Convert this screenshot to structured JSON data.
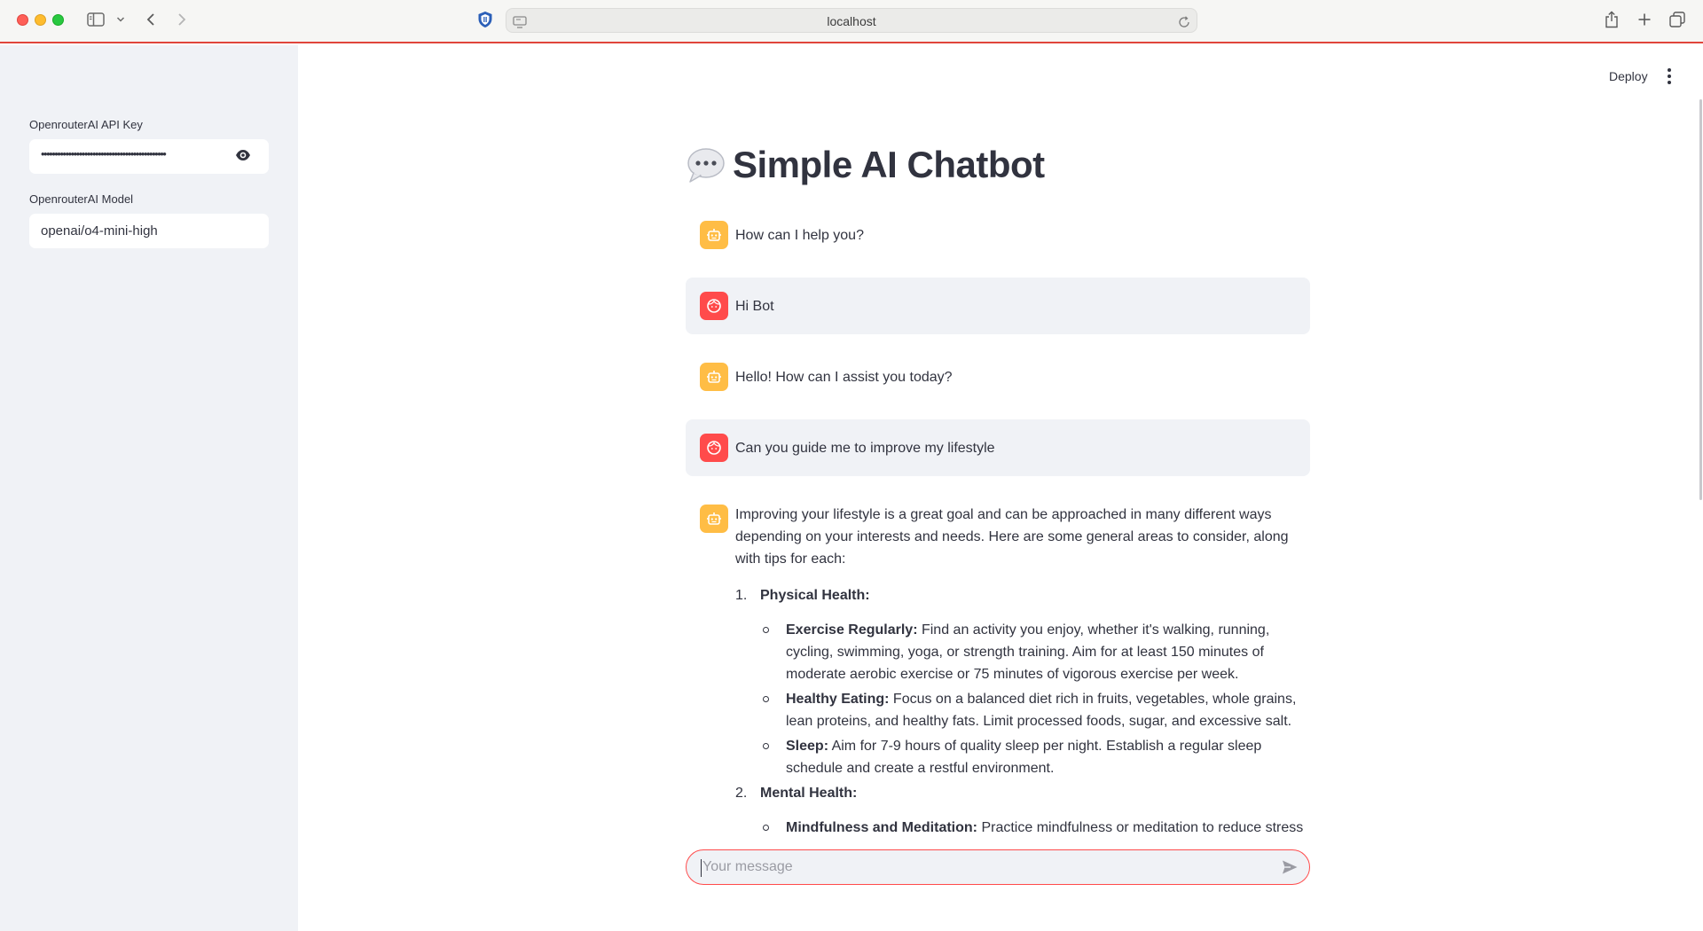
{
  "browser": {
    "url": "localhost"
  },
  "sidebar": {
    "api_key_label": "OpenrouterAI API Key",
    "api_key_value": "••••••••••••••••••••••••••••••••••••••••••••••",
    "model_label": "OpenrouterAI Model",
    "model_value": "openai/o4-mini-high"
  },
  "header": {
    "deploy_label": "Deploy"
  },
  "main": {
    "title": "Simple AI Chatbot",
    "messages": [
      {
        "role": "assistant",
        "text": "How can I help you?"
      },
      {
        "role": "user",
        "text": "Hi Bot"
      },
      {
        "role": "assistant",
        "text": "Hello! How can I assist you today?"
      },
      {
        "role": "user",
        "text": "Can you guide me to improve my lifestyle"
      }
    ],
    "answer": {
      "intro": "Improving your lifestyle is a great goal and can be approached in many different ways depending on your interests and needs. Here are some general areas to consider, along with tips for each:",
      "sections": [
        {
          "number": "1.",
          "title": "Physical Health:",
          "items": [
            {
              "label": "Exercise Regularly:",
              "text": " Find an activity you enjoy, whether it's walking, running, cycling, swimming, yoga, or strength training. Aim for at least 150 minutes of moderate aerobic exercise or 75 minutes of vigorous exercise per week."
            },
            {
              "label": "Healthy Eating:",
              "text": " Focus on a balanced diet rich in fruits, vegetables, whole grains, lean proteins, and healthy fats. Limit processed foods, sugar, and excessive salt."
            },
            {
              "label": "Sleep:",
              "text": " Aim for 7-9 hours of quality sleep per night. Establish a regular sleep schedule and create a restful environment."
            }
          ]
        },
        {
          "number": "2.",
          "title": "Mental Health:",
          "items": [
            {
              "label": "Mindfulness and Meditation:",
              "text": " Practice mindfulness or meditation to reduce stress and improve mental clarity. Even a few minutes a day can make a difference."
            }
          ]
        }
      ]
    }
  },
  "chat_input": {
    "placeholder": "Your message"
  },
  "colors": {
    "bot_avatar": "#ffbd45",
    "user_avatar": "#ff4b4b",
    "sidebar_bg": "#f0f2f6",
    "accent": "#ff4b4b"
  },
  "icons": [
    "sidebar-toggle-icon",
    "chevron-down-icon",
    "back-icon",
    "forward-icon",
    "shield-icon",
    "site-icon",
    "reload-icon",
    "share-icon",
    "new-tab-icon",
    "tabs-overview-icon",
    "eye-icon",
    "kebab-menu-icon",
    "speech-bubble-icon",
    "robot-icon",
    "face-icon",
    "send-icon"
  ]
}
